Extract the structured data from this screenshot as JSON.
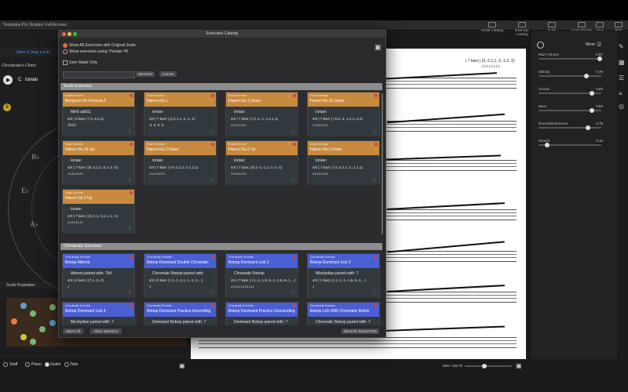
{
  "app": {
    "title": "Tessitura Pro Scales: Full Access"
  },
  "toolbar": [
    {
      "label": "Scale Catalog"
    },
    {
      "label": "Exercise Catalog"
    },
    {
      "label": "Scale Comparison"
    },
    {
      "label": "Scale Painter"
    },
    {
      "label": "Save"
    },
    {
      "label": "Print"
    }
  ],
  "left_panel": {
    "open_drag_label": "Open & Drag a sub",
    "chordscale_label": "Chordscale's Chord",
    "play_key": "C",
    "play_mode": "Ionian",
    "s_badge": "S",
    "notes": [
      "B♭",
      "E♭",
      "A♭"
    ],
    "scale_properties": "Scale Properties"
  },
  "bottom_bar": {
    "view_options": [
      "Staff",
      "Piano",
      "Guitar",
      "Tabs"
    ],
    "selected_view": "Guitar",
    "size_label": "Size: 129.70"
  },
  "score": {
    "header_text": "| 7 bars | (5,-2,1,1,-2,-1,2,-3)"
  },
  "mixer": {
    "title": "Mixer",
    "channels": [
      {
        "label": "Main Volume",
        "value": "0.97"
      },
      {
        "label": "Melody",
        "value": "0.76"
      },
      {
        "label": "Chords",
        "value": "0.84"
      },
      {
        "label": "Bass",
        "value": "0.84"
      },
      {
        "label": "Drums/Metronome",
        "value": "0.78"
      },
      {
        "label": "Reverb",
        "value": "0.10"
      }
    ]
  },
  "dialog": {
    "title": "Exercises Catalog",
    "option_all": "Show All Exercises with Original Scale",
    "option_using": "Show exercises using: Persian #9",
    "user_made_only": "User Made Only",
    "search_btn": "SEARCH",
    "clear_btn": "CLEAR",
    "section_scale": "Scale Exercises",
    "section_chord": "Chordscale Exercises",
    "scale_cards": [
      {
        "category": "Scale Exercise",
        "name": "Bergonzi m6 Formula 8",
        "line1": "Min6 add11",
        "line2": "4/4 | 3 bars | (-3,-2,2,2)",
        "line3": "𝅘𝅥𝅯𝅘𝅥𝅯𝅘𝅥𝅯𝅘𝅥𝅯"
      },
      {
        "category": "Scale Exercise",
        "name": "Hanon No.1",
        "line1": "Ionian",
        "line2": "4/4 | 7 bars | (2,1,1,1,-1,-1,-1)",
        "line3": "♬♬♬♬"
      },
      {
        "category": "Scale Exercise",
        "name": "Hanon No.1 Down",
        "line1": "Ionian",
        "line2": "4/4 | 7 bars | (-2,-1,-1,-1,1,1,1)",
        "line3": "♪♪♪♪♪♪♪♪"
      },
      {
        "category": "Scale Exercise",
        "name": "Hanon No.1b Down",
        "line1": "Ionian",
        "line2": "4/4 | 7 bars | (-5,2,-1,-1,2,1,-3,2)",
        "line3": "♪♪♪♪♪♪♪♪"
      },
      {
        "category": "Scale Exercise",
        "name": "Hanon No.1b Up",
        "line1": "Ionian",
        "line2": "4/4 | 7 bars | (5,-2,1,1,-2,-1,2,-3)",
        "line3": "♪♪♪♪♪♪♪♪"
      },
      {
        "category": "Scale Exercise",
        "name": "Hanon No.2 Down",
        "line1": "Ionian",
        "line2": "4/4 | 7 bars | (-5,-2,1,1,-1,1,1,1)",
        "line3": "♪♪♪♪♪♪♪♪"
      },
      {
        "category": "Scale Exercise",
        "name": "Hanon No.2 Up",
        "line1": "Ionian",
        "line2": "4/4 | 7 bars | (5,2,-1,-1,1,-1,-1,-1)",
        "line3": "♪♪♪♪♪♪♪♪"
      },
      {
        "category": "Scale Exercise",
        "name": "Hanon No.3 Down",
        "line1": "Ionian",
        "line2": "4/4 | 7 bars | (-2,-3,1,1,-1,-1,1,1)",
        "line3": "♪♪♪♪♪♪♪♪"
      },
      {
        "category": "Scale Exercise",
        "name": "Hanon No.3 Up",
        "line1": "Ionian",
        "line2": "4/4 | 7 bars | (2,3,-1,-1,1,1,-1,-1)",
        "line3": "♪♪♪♪♪♪♪♪"
      }
    ],
    "chord_cards": [
      {
        "category": "Chordscale Exercise",
        "name": "Bebop Altered",
        "line1": "Altered paired with: 7b5",
        "line2": "4/4 | 4 bars | (7,1,-2,-2)",
        "line3": "♪"
      },
      {
        "category": "Chordscale Exercise",
        "name": "Bebop Dominant Double Chromatic",
        "line1": "Chromatic Bebop paired with:",
        "line2": "4/4 | 2 bars | (-1,-1,-1,1,-1,-1,-1,...)",
        "line3": "♪"
      },
      {
        "category": "Chordscale Exercise",
        "name": "Bebop Dominant Lick 2",
        "line1": "Chromatic Bebop",
        "line2": "4/4 | 7 bars | (-1,-1,-1,8,-6,-1,-1,8,-6,-1,...)",
        "line3": "♪♪♪♪♪♪♪♪♪♪♪♪"
      },
      {
        "category": "Chordscale Exercise",
        "name": "Bebop Dominant Lick 3",
        "line1": "Mixolydian paired with: 7",
        "line2": "4/4 | 2 bars | (-1,-1,-1,-1,8,-6,-1,...)",
        "line3": "♪"
      },
      {
        "category": "Chordscale Exercise",
        "name": "Bebop Dominant Lick 4",
        "line1": "Mixolydian paired with: 7",
        "line2": "",
        "line3": ""
      },
      {
        "category": "Chordscale Exercise",
        "name": "Bebop Dominant Practice Ascending",
        "line1": "Dominant Bebop paired with: 7",
        "line2": "",
        "line3": ""
      },
      {
        "category": "Chordscale Exercise",
        "name": "Bebop Dominant Practice Descending",
        "line1": "Dominant Bebop paired with: 7",
        "line2": "",
        "line3": ""
      },
      {
        "category": "Chordscale Exercise",
        "name": "Bebop Lick With Chromatic Below",
        "line1": "Chromatic Bebop paired with: 7",
        "line2": "",
        "line3": ""
      }
    ],
    "select_all": "Select All",
    "clear_selection": "Clear Selection",
    "delete_selected": "DELETE SELECTED"
  },
  "colors": {
    "scale_card_header": "#c88a3e",
    "chord_card_header": "#4a5fd4",
    "card_body": "#31393f"
  }
}
